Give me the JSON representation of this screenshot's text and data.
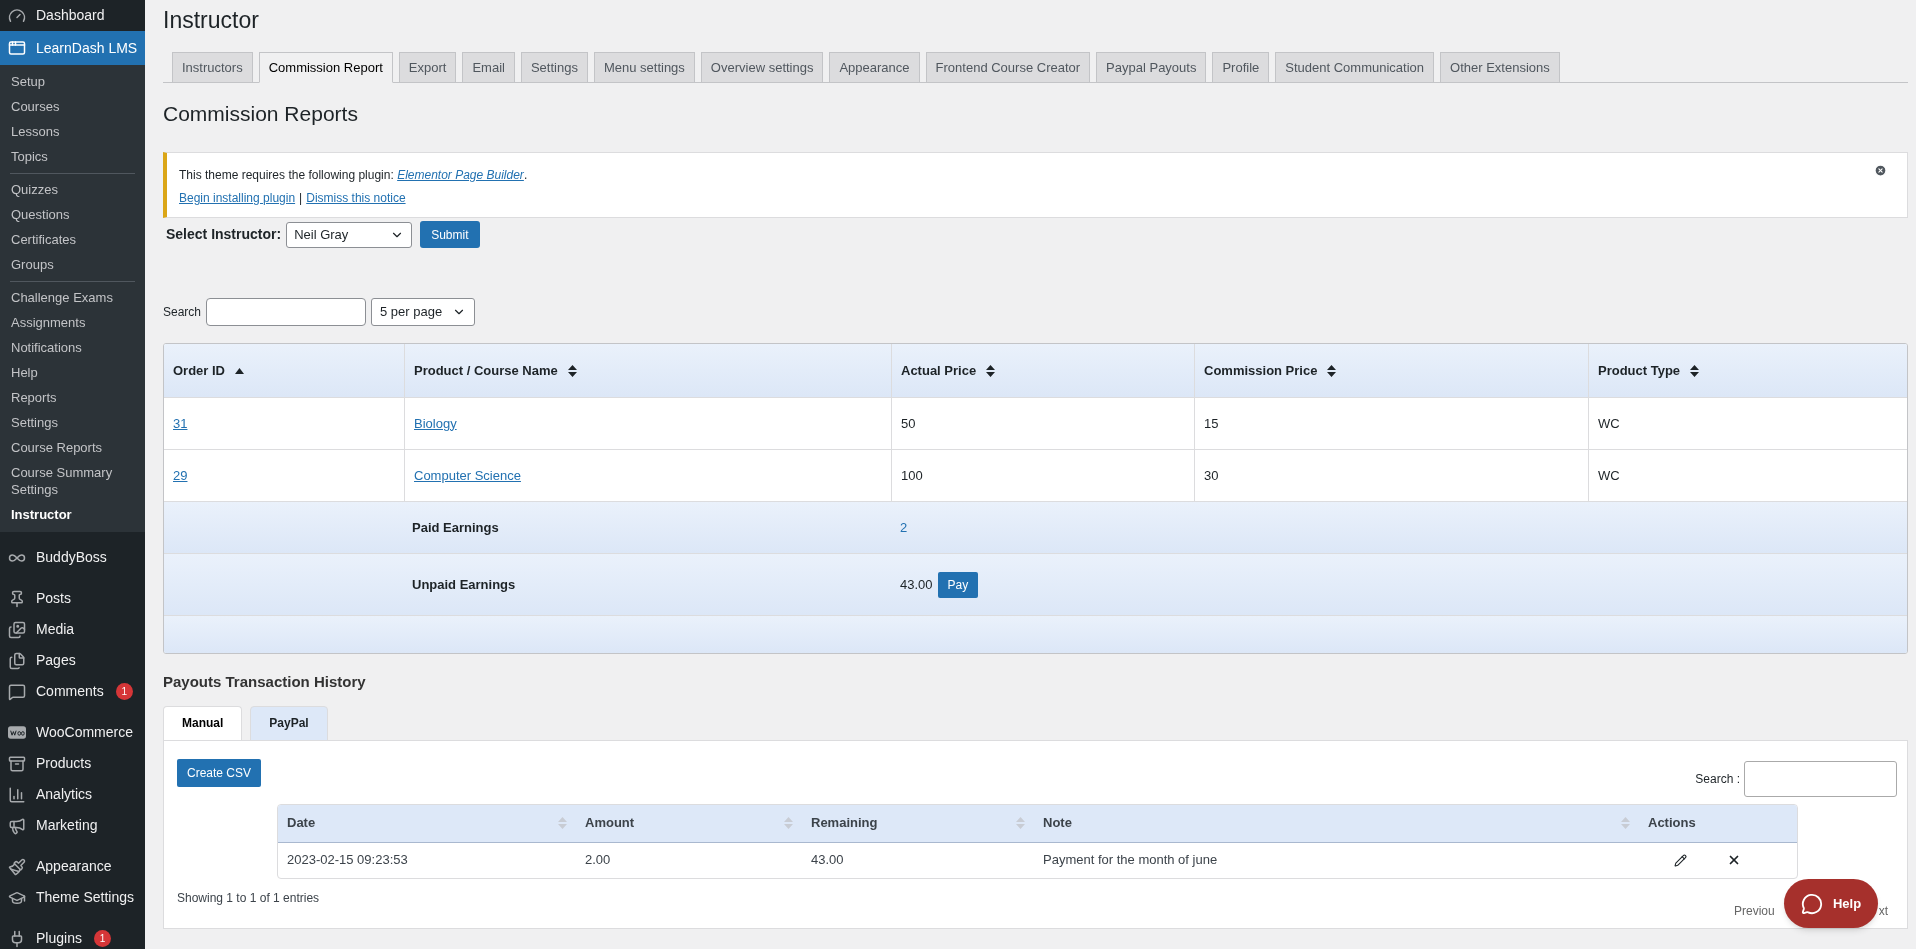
{
  "sidebar": {
    "groups": [
      {
        "items": [
          {
            "label": "Dashboard",
            "selected": false
          }
        ]
      },
      {
        "items": [
          {
            "label": "LearnDash LMS",
            "selected": true,
            "submenu": [
              {
                "items": [
                  {
                    "label": "Setup",
                    "selected": false
                  },
                  {
                    "label": "Courses",
                    "selected": false
                  },
                  {
                    "label": "Lessons",
                    "selected": false
                  },
                  {
                    "label": "Topics",
                    "selected": false
                  }
                ]
              },
              {
                "items": [
                  {
                    "label": "Quizzes",
                    "selected": false
                  },
                  {
                    "label": "Questions",
                    "selected": false
                  },
                  {
                    "label": "Certificates",
                    "selected": false
                  },
                  {
                    "label": "Groups",
                    "selected": false
                  }
                ]
              },
              {
                "items": [
                  {
                    "label": "Challenge Exams",
                    "selected": false
                  },
                  {
                    "label": "Assignments",
                    "selected": false
                  },
                  {
                    "label": "Notifications",
                    "selected": false
                  },
                  {
                    "label": "Help",
                    "selected": false
                  },
                  {
                    "label": "Reports",
                    "selected": false
                  },
                  {
                    "label": "Settings",
                    "selected": false
                  },
                  {
                    "label": "Course Reports",
                    "selected": false
                  },
                  {
                    "label": "Course Summary Settings",
                    "selected": false
                  },
                  {
                    "label": "Instructor",
                    "selected": true
                  }
                ]
              }
            ]
          }
        ]
      },
      {
        "items": [
          {
            "label": "BuddyBoss",
            "selected": false
          }
        ]
      },
      {
        "items": [
          {
            "label": "Posts",
            "selected": false
          },
          {
            "label": "Media",
            "selected": false
          },
          {
            "label": "Pages",
            "selected": false
          },
          {
            "label": "Comments",
            "selected": false,
            "badge": "1"
          }
        ]
      },
      {
        "items": [
          {
            "label": "WooCommerce",
            "selected": false
          },
          {
            "label": "Products",
            "selected": false
          },
          {
            "label": "Analytics",
            "selected": false
          },
          {
            "label": "Marketing",
            "selected": false
          }
        ]
      },
      {
        "items": [
          {
            "label": "Appearance",
            "selected": false
          },
          {
            "label": "Theme Settings",
            "selected": false
          }
        ]
      },
      {
        "items": [
          {
            "label": "Plugins",
            "selected": false,
            "badge": "1"
          }
        ]
      }
    ]
  },
  "page_title": "Instructor",
  "tabs": [
    {
      "label": "Instructors",
      "selected": false
    },
    {
      "label": "Commission Report",
      "selected": true
    },
    {
      "label": "Export",
      "selected": false
    },
    {
      "label": "Email",
      "selected": false
    },
    {
      "label": "Settings",
      "selected": false
    },
    {
      "label": "Menu settings",
      "selected": false
    },
    {
      "label": "Overview settings",
      "selected": false
    },
    {
      "label": "Appearance",
      "selected": false
    },
    {
      "label": "Frontend Course Creator",
      "selected": false
    },
    {
      "label": "Paypal Payouts",
      "selected": false
    },
    {
      "label": "Profile",
      "selected": false
    },
    {
      "label": "Student Communication",
      "selected": false
    },
    {
      "label": "Other Extensions",
      "selected": false
    }
  ],
  "section_title": "Commission Reports",
  "notice": {
    "message_prefix": "This theme requires the following plugin: ",
    "plugin_link": "Elementor Page Builder",
    "message_suffix": ".",
    "links": [
      "Begin installing plugin",
      "Dismiss this notice"
    ],
    "link_separator": "|"
  },
  "instructor_select": {
    "label": "Select Instructor:",
    "value": "Neil Gray",
    "button": "Submit"
  },
  "search": {
    "label": "Search",
    "per_page": "5 per page"
  },
  "commission_table": {
    "columns": [
      {
        "label": "Order ID",
        "sorted": true
      },
      {
        "label": "Product / Course Name",
        "sorted": false
      },
      {
        "label": "Actual Price",
        "sorted": false
      },
      {
        "label": "Commission Price",
        "sorted": false
      },
      {
        "label": "Product Type",
        "sorted": false
      }
    ],
    "rows": [
      {
        "order_id": "31",
        "product": "Biology",
        "actual_price": "50",
        "commission_price": "15",
        "product_type": "WC"
      },
      {
        "order_id": "29",
        "product": "Computer Science",
        "actual_price": "100",
        "commission_price": "30",
        "product_type": "WC"
      }
    ],
    "paid_earnings": {
      "label": "Paid Earnings",
      "value": "2"
    },
    "unpaid_earnings": {
      "label": "Unpaid Earnings",
      "value": "43.00",
      "button": "Pay"
    }
  },
  "payouts": {
    "title": "Payouts Transaction History",
    "tabs": [
      {
        "label": "Manual",
        "selected": true
      },
      {
        "label": "PayPal",
        "selected": false
      }
    ],
    "csv_button": "Create CSV",
    "search_label": "Search :",
    "columns": [
      "Date",
      "Amount",
      "Remaining",
      "Note",
      "Actions"
    ],
    "rows": [
      {
        "date": "2023-02-15 09:23:53",
        "amount": "2.00",
        "remaining": "43.00",
        "note": "Payment for the month of june"
      }
    ],
    "info": "Showing 1 to 1 of 1 entries",
    "previous": "Previou",
    "next": "xt"
  },
  "help_button": "Help"
}
